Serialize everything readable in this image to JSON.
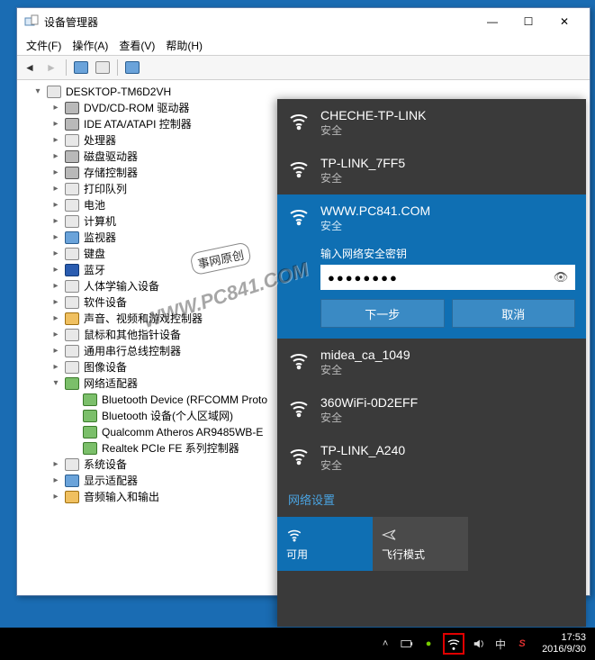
{
  "window": {
    "title": "设备管理器",
    "menubar": [
      "文件(F)",
      "操作(A)",
      "查看(V)",
      "帮助(H)"
    ]
  },
  "tree": {
    "root": "DESKTOP-TM6D2VH",
    "nodes": [
      {
        "label": "DVD/CD-ROM 驱动器",
        "ico": "disk"
      },
      {
        "label": "IDE ATA/ATAPI 控制器",
        "ico": "disk"
      },
      {
        "label": "处理器",
        "ico": "pc"
      },
      {
        "label": "磁盘驱动器",
        "ico": "disk"
      },
      {
        "label": "存储控制器",
        "ico": "disk"
      },
      {
        "label": "打印队列",
        "ico": "pc"
      },
      {
        "label": "电池",
        "ico": "pc"
      },
      {
        "label": "计算机",
        "ico": "pc"
      },
      {
        "label": "监视器",
        "ico": "mon"
      },
      {
        "label": "键盘",
        "ico": "pc"
      },
      {
        "label": "蓝牙",
        "ico": "bt"
      },
      {
        "label": "人体学输入设备",
        "ico": "pc"
      },
      {
        "label": "软件设备",
        "ico": "pc"
      },
      {
        "label": "声音、视频和游戏控制器",
        "ico": "snd"
      },
      {
        "label": "鼠标和其他指针设备",
        "ico": "pc"
      },
      {
        "label": "通用串行总线控制器",
        "ico": "pc"
      },
      {
        "label": "图像设备",
        "ico": "pc"
      }
    ],
    "network_label": "网络适配器",
    "network_children": [
      "Bluetooth Device (RFCOMM Proto",
      "Bluetooth 设备(个人区域网)",
      "Qualcomm Atheros AR9485WB-E",
      "Realtek PCIe FE 系列控制器"
    ],
    "tail": [
      {
        "label": "系统设备",
        "ico": "pc"
      },
      {
        "label": "显示适配器",
        "ico": "mon"
      },
      {
        "label": "音频输入和输出",
        "ico": "snd"
      }
    ]
  },
  "wifi": {
    "items": [
      {
        "ssid": "CHECHE-TP-LINK",
        "status": "安全"
      },
      {
        "ssid": "TP-LINK_7FF5",
        "status": "安全"
      },
      {
        "ssid": "WWW.PC841.COM",
        "status": "安全",
        "active": true
      },
      {
        "ssid": "midea_ca_1049",
        "status": "安全"
      },
      {
        "ssid": "360WiFi-0D2EFF",
        "status": "安全"
      },
      {
        "ssid": "TP-LINK_A240",
        "status": "安全"
      }
    ],
    "connect_prompt": "输入网络安全密钥",
    "password_mask": "●●●●●●●●",
    "btn_next": "下一步",
    "btn_cancel": "取消",
    "settings_label": "网络设置",
    "tile_wifi": "可用",
    "tile_airplane": "飞行模式"
  },
  "taskbar": {
    "ime": "中",
    "time": "17:53",
    "date": "2016/9/30"
  },
  "watermark": {
    "bubble": "事网原创",
    "text": "WWW.PC841.COM"
  }
}
